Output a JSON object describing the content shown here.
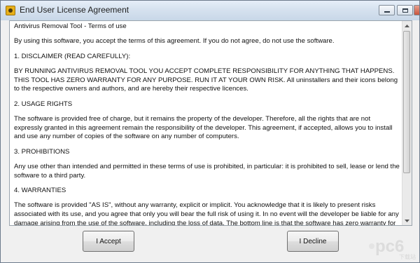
{
  "window": {
    "title": "End User License Agreement"
  },
  "license": {
    "paragraphs": [
      "Antivirus Removal Tool - Terms of use",
      "By using this software, you accept the terms of this agreement. If you do not agree, do not use the software.",
      "1. DISCLAIMER (READ CAREFULLY):",
      "BY RUNNING ANTIVIRUS REMOVAL TOOL YOU ACCEPT COMPLETE RESPONSIBILITY FOR ANYTHING THAT HAPPENS. THIS TOOL HAS ZERO WARRANTY FOR ANY PURPOSE. RUN IT AT YOUR OWN RISK. All uninstallers and their icons belong to the respective owners and authors, and are hereby their respective licences.",
      "2. USAGE RIGHTS",
      "The software is provided free of charge, but it remains the property of the developer. Therefore, all the rights that are not expressly granted in this agreement remain the responsibility of the developer. This agreement, if accepted, allows you to install and use any number of copies of the software on any number of computers.",
      "3. PROHIBITIONS",
      "Any use other than intended and permitted in these terms of use is prohibited, in particular: it is prohibited to sell, lease or lend the software to a third party.",
      "4. WARRANTIES",
      "The software is provided \"AS IS\", without any warranty, explicit or implicit. You acknowledge that it is likely to present risks associated with its use, and you agree that only you will bear the full risk of using it. In no event will the developer be liable for any damage arising from the use of the software, including the loss of data. The bottom line is that the software has zero warranty for any purpose. Use it at your own risk."
    ]
  },
  "buttons": {
    "accept": "I Accept",
    "decline": "I Decline"
  },
  "watermark": {
    "text": "pc6",
    "subtext": "下载站"
  },
  "icons": {
    "app": "app-shield-icon",
    "minimize": "minimize-icon",
    "maximize": "maximize-icon",
    "close": "close-icon",
    "scroll_up": "scroll-up-arrow-icon",
    "scroll_down": "scroll-down-arrow-icon"
  },
  "colors": {
    "titlebar": "#d6e2ef",
    "close_button": "#c8533d",
    "watermark": "#e2e2e2"
  }
}
